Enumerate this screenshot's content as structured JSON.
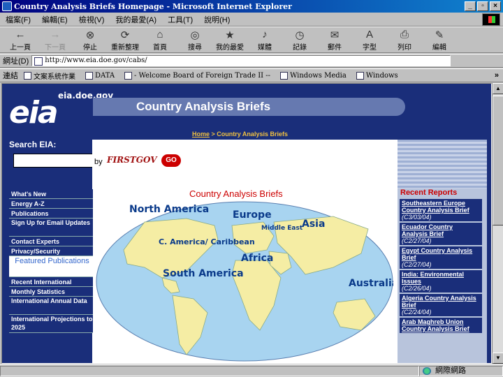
{
  "window": {
    "title": "Country Analysis Briefs Homepage - Microsoft Internet Explorer",
    "controls": [
      "_",
      "▫",
      "×"
    ]
  },
  "menu": [
    "檔案(F)",
    "編輯(E)",
    "檢視(V)",
    "我的最愛(A)",
    "工具(T)",
    "說明(H)"
  ],
  "toolbar": [
    {
      "label": "上一頁",
      "icon": "←",
      "name": "back-button",
      "disabled": false
    },
    {
      "label": "下一頁",
      "icon": "→",
      "name": "forward-button",
      "disabled": true
    },
    {
      "label": "停止",
      "icon": "⊗",
      "name": "stop-button",
      "disabled": false
    },
    {
      "label": "重新整理",
      "icon": "⟳",
      "name": "refresh-button",
      "disabled": false
    },
    {
      "label": "首頁",
      "icon": "⌂",
      "name": "home-button",
      "disabled": false
    },
    {
      "label": "搜尋",
      "icon": "◎",
      "name": "search-button",
      "disabled": false
    },
    {
      "label": "我的最愛",
      "icon": "★",
      "name": "favorites-button",
      "disabled": false
    },
    {
      "label": "媒體",
      "icon": "♪",
      "name": "media-button",
      "disabled": false
    },
    {
      "label": "記錄",
      "icon": "◷",
      "name": "history-button",
      "disabled": false
    },
    {
      "label": "郵件",
      "icon": "✉",
      "name": "mail-button",
      "disabled": false
    },
    {
      "label": "字型",
      "icon": "A",
      "name": "font-button",
      "disabled": false
    },
    {
      "label": "列印",
      "icon": "⎙",
      "name": "print-button",
      "disabled": false
    },
    {
      "label": "編輯",
      "icon": "✎",
      "name": "edit-button",
      "disabled": false
    }
  ],
  "address": {
    "label": "網址(D)",
    "value": "http://www.eia.doe.gov/cabs/"
  },
  "links": {
    "label": "連結",
    "items": [
      "文案系統作業",
      "DATA",
      "- Welcome Board of Foreign Trade II --",
      "Windows Media",
      "Windows"
    ]
  },
  "page": {
    "domain": "eia.doe.gov",
    "logo_text": "eia",
    "banner": "Country Analysis Briefs",
    "breadcrumb_home": "Home",
    "breadcrumb_rest": " > Country Analysis Briefs",
    "search_label": "Search EIA:",
    "search_by": "by",
    "firstgov": "FIRSTGOV",
    "go": "GO",
    "heading": "Country Analysis Briefs",
    "recent_heading": "Recent Reports",
    "nav": [
      {
        "label": "What's New",
        "type": "normal"
      },
      {
        "label": "Energy A-Z",
        "type": "normal"
      },
      {
        "label": "Publications",
        "type": "normal"
      },
      {
        "label": "Sign Up for Email Updates",
        "type": "tall"
      },
      {
        "label": "Contact Experts",
        "type": "normal"
      },
      {
        "label": "Privacy/Security",
        "type": "normal"
      },
      {
        "label": "Featured Publications",
        "type": "featured"
      },
      {
        "label": "Recent International",
        "type": "normal"
      },
      {
        "label": "Monthly Statistics",
        "type": "normal"
      },
      {
        "label": "International Annual Data",
        "type": "tall"
      },
      {
        "label": "International Projections to 2025",
        "type": "tall"
      }
    ],
    "reports": [
      {
        "title": "Southeastern Europe Country Analysis Brief",
        "date": "(C3/03/04)"
      },
      {
        "title": "Ecuador Country Analysis Brief",
        "date": "(C2/27/04)"
      },
      {
        "title": "Egypt Country Analysis Brief",
        "date": "(C2/27/04)"
      },
      {
        "title": "India: Environmental Issues",
        "date": "(C2/26/04)"
      },
      {
        "title": "Algeria Country Analysis Brief",
        "date": "(C2/24/04)"
      },
      {
        "title": "Arab Maghreb Union Country Analysis Brief",
        "date": ""
      }
    ],
    "regions": [
      "North America",
      "Europe",
      "Middle East",
      "Asia",
      "C. America/ Caribbean",
      "Africa",
      "South America",
      "Australia/ Oceania"
    ]
  },
  "status": {
    "left": "",
    "zone": "網際網路"
  }
}
